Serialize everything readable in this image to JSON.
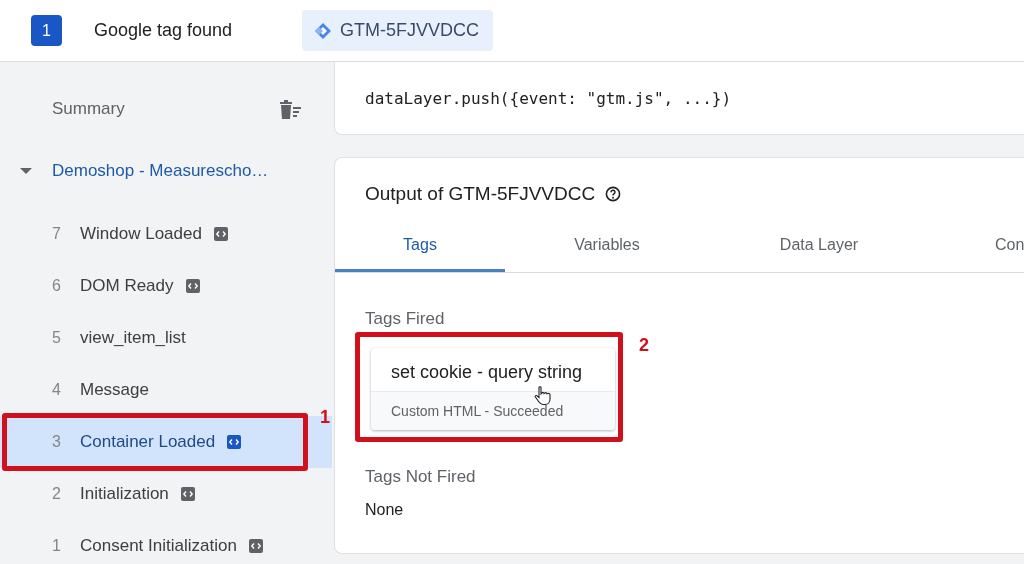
{
  "header": {
    "count": "1",
    "title": "Google tag found",
    "container_chip": "GTM-5FJVVDCC"
  },
  "sidebar": {
    "summary": "Summary",
    "container": {
      "label": "Demoshop - Measurescho…",
      "expanded": true
    },
    "events": [
      {
        "number": "7",
        "label": "Window Loaded",
        "has_icon": true,
        "selected": false
      },
      {
        "number": "6",
        "label": "DOM Ready",
        "has_icon": true,
        "selected": false
      },
      {
        "number": "5",
        "label": "view_item_list",
        "has_icon": false,
        "selected": false
      },
      {
        "number": "4",
        "label": "Message",
        "has_icon": false,
        "selected": false
      },
      {
        "number": "3",
        "label": "Container Loaded",
        "has_icon": true,
        "selected": true,
        "annotation": "1"
      },
      {
        "number": "2",
        "label": "Initialization",
        "has_icon": true,
        "selected": false
      },
      {
        "number": "1",
        "label": "Consent Initialization",
        "has_icon": true,
        "selected": false
      }
    ]
  },
  "code_card": {
    "code": "dataLayer.push({event: \"gtm.js\", ...})"
  },
  "output": {
    "title": "Output of GTM-5FJVVDCC",
    "tabs": [
      {
        "label": "Tags",
        "selected": true
      },
      {
        "label": "Variables",
        "selected": false
      },
      {
        "label": "Data Layer",
        "selected": false
      },
      {
        "label": "Con",
        "selected": false
      }
    ],
    "fired_heading": "Tags Fired",
    "fired": [
      {
        "name": "set cookie - query string",
        "status": "Custom HTML - Succeeded",
        "annotation": "2"
      }
    ],
    "not_fired_heading": "Tags Not Fired",
    "not_fired": "None"
  }
}
